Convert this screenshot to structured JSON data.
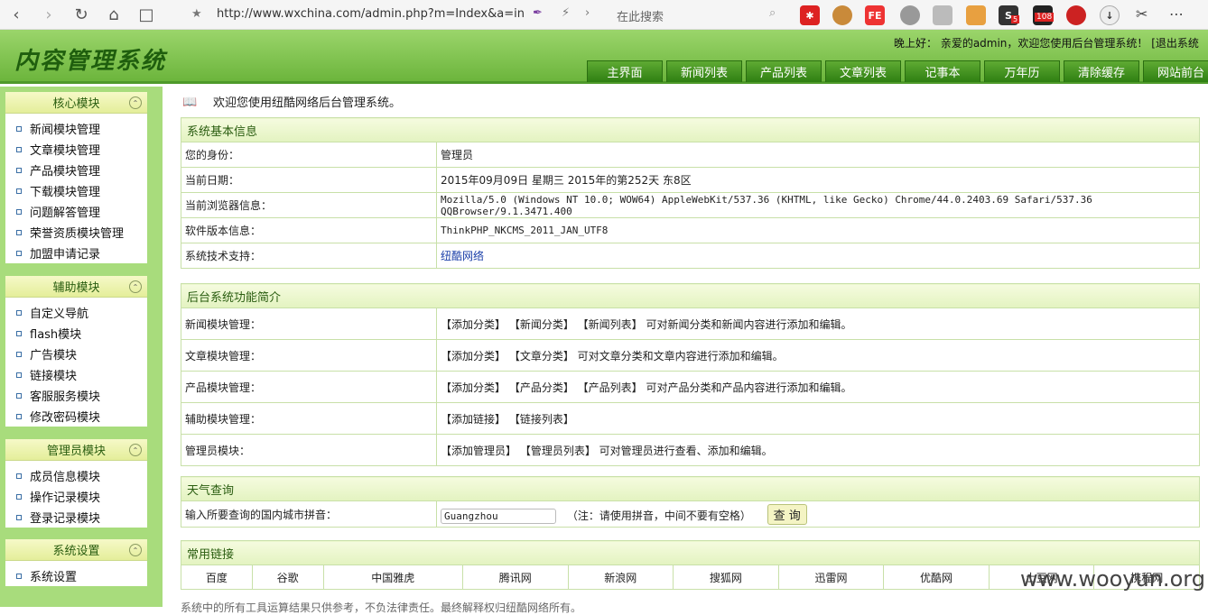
{
  "browser": {
    "url": "http://www.wxchina.com/admin.php?m=Index&a=in",
    "search_placeholder": "在此搜索",
    "ext_badges": [
      "5",
      "108"
    ]
  },
  "header": {
    "logo": "内容管理系统",
    "welcome": "晚上好： 亲爱的admin，欢迎您使用后台管理系统！ [退出系统",
    "tabs": [
      "主界面",
      "新闻列表",
      "产品列表",
      "文章列表",
      "记事本",
      "万年历",
      "清除缓存",
      "网站前台"
    ]
  },
  "sidebar": {
    "modules": [
      {
        "title": "核心模块",
        "items": [
          "新闻模块管理",
          "文章模块管理",
          "产品模块管理",
          "下载模块管理",
          "问题解答管理",
          "荣誉资质模块管理",
          "加盟申请记录"
        ]
      },
      {
        "title": "辅助模块",
        "items": [
          "自定义导航",
          "flash模块",
          "广告模块",
          "链接模块",
          "客服服务模块",
          "修改密码模块"
        ]
      },
      {
        "title": "管理员模块",
        "items": [
          "成员信息模块",
          "操作记录模块",
          "登录记录模块"
        ]
      },
      {
        "title": "系统设置",
        "items": [
          "系统设置"
        ]
      }
    ]
  },
  "main": {
    "greeting": "欢迎您使用纽酷网络后台管理系统。",
    "sysinfo": {
      "title": "系统基本信息",
      "rows": [
        {
          "k": "您的身份：",
          "v": "管理员"
        },
        {
          "k": "当前日期：",
          "v": "2015年09月09日   星期三  2015年的第252天 东8区"
        },
        {
          "k": "当前浏览器信息：",
          "v": "Mozilla/5.0 (Windows NT 10.0; WOW64) AppleWebKit/537.36 (KHTML, like Gecko) Chrome/44.0.2403.69 Safari/537.36 QQBrowser/9.1.3471.400"
        },
        {
          "k": "软件版本信息：",
          "v": "ThinkPHP_NKCMS_2011_JAN_UTF8"
        },
        {
          "k": "系统技术支持：",
          "v": "纽酷网络"
        }
      ]
    },
    "functions": {
      "title": "后台系统功能简介",
      "rows": [
        {
          "k": "新闻模块管理：",
          "v": "【添加分类】 【新闻分类】 【新闻列表】 可对新闻分类和新闻内容进行添加和编辑。"
        },
        {
          "k": "文章模块管理：",
          "v": "【添加分类】 【文章分类】 可对文章分类和文章内容进行添加和编辑。"
        },
        {
          "k": "产品模块管理：",
          "v": "【添加分类】 【产品分类】 【产品列表】 可对产品分类和产品内容进行添加和编辑。"
        },
        {
          "k": "辅助模块管理：",
          "v": "【添加链接】 【链接列表】"
        },
        {
          "k": "管理员模块：",
          "v": "【添加管理员】 【管理员列表】 可对管理员进行查看、添加和编辑。"
        }
      ]
    },
    "weather": {
      "title": "天气查询",
      "label": "输入所要查询的国内城市拼音：",
      "value": "Guangzhou",
      "note": "（注：请使用拼音，中间不要有空格）",
      "button": "查 询"
    },
    "links": {
      "title": "常用链接",
      "items": [
        "百度",
        "谷歌",
        "中国雅虎",
        "腾讯网",
        "新浪网",
        "搜狐网",
        "迅雷网",
        "优酷网",
        "土豆网",
        "携程网"
      ]
    },
    "footer": "系统中的所有工具运算结果只供参考，不负法律责任。最终解释权归纽酷网络所有。",
    "watermark": "www.wooyun.org"
  }
}
